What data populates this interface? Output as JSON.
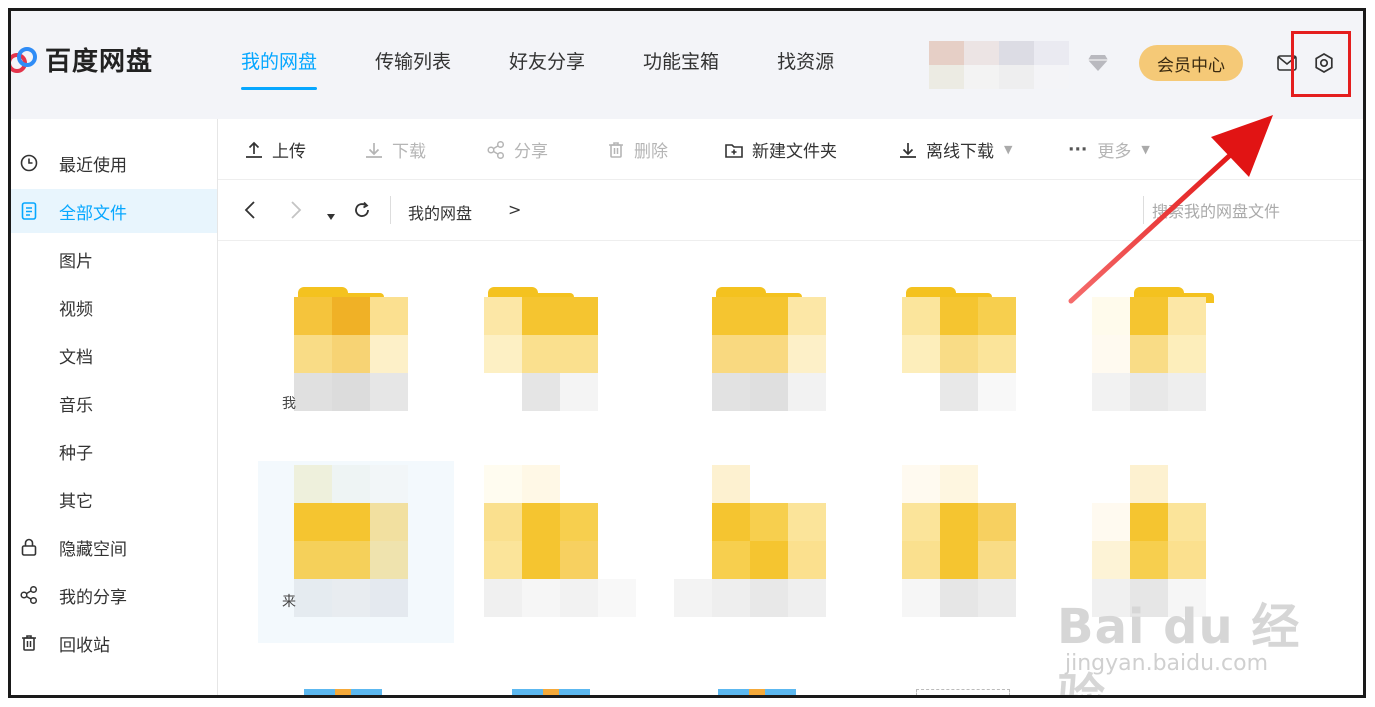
{
  "app": {
    "name": "百度网盘"
  },
  "nav": {
    "items": [
      "我的网盘",
      "传输列表",
      "好友分享",
      "功能宝箱",
      "找资源"
    ],
    "active": 0
  },
  "header": {
    "member_label": "会员中心"
  },
  "sidebar": {
    "items": [
      {
        "label": "最近使用",
        "icon": "clock-icon"
      },
      {
        "label": "全部文件",
        "icon": "document-icon",
        "active": true
      },
      {
        "label": "图片"
      },
      {
        "label": "视频"
      },
      {
        "label": "文档"
      },
      {
        "label": "音乐"
      },
      {
        "label": "种子"
      },
      {
        "label": "其它"
      },
      {
        "label": "隐藏空间",
        "icon": "lock-icon"
      },
      {
        "label": "我的分享",
        "icon": "share-icon"
      },
      {
        "label": "回收站",
        "icon": "trash-icon"
      }
    ]
  },
  "toolbar": {
    "upload": "上传",
    "download": "下载",
    "share": "分享",
    "delete": "删除",
    "new_folder": "新建文件夹",
    "offline_download": "离线下载",
    "more": "更多"
  },
  "breadcrumb": {
    "current": "我的网盘",
    "separator": ">"
  },
  "search": {
    "placeholder": "搜索我的网盘文件"
  },
  "files": {
    "labels": [
      "我",
      "来"
    ]
  },
  "watermark": {
    "main": "Bai du 经验",
    "sub": "jingyan.baidu.com"
  },
  "colors": {
    "accent": "#06a7ff",
    "member": "#f5c977",
    "folder": "#f4c21f",
    "highlight": "#e41e1e"
  }
}
